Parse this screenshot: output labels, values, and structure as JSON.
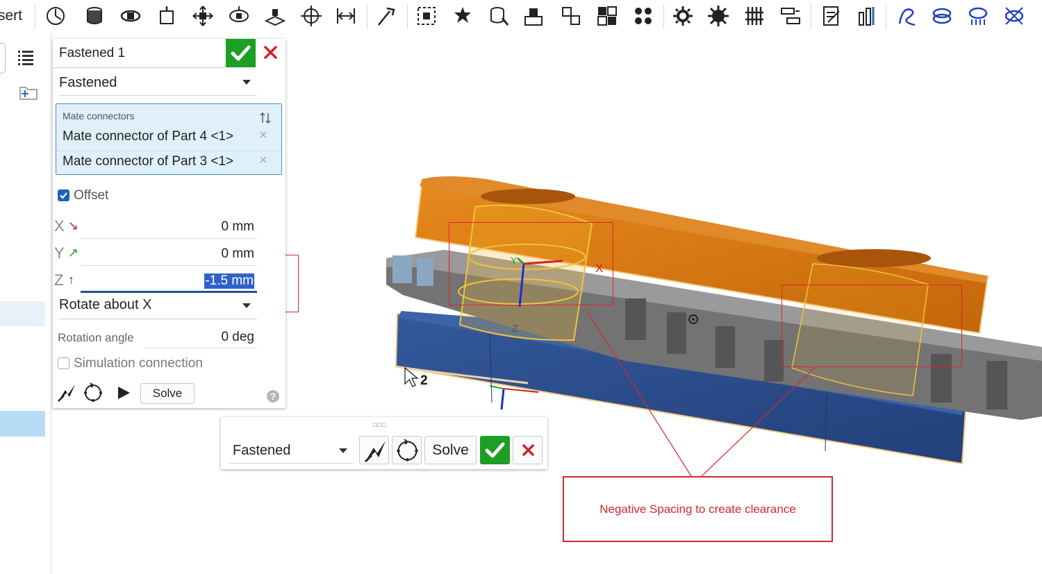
{
  "toolbar": {
    "insert_label": "sert",
    "icons": [
      "clock-icon",
      "cylinder-icon",
      "revolute-icon",
      "slider-icon",
      "move-icon",
      "rotate-icon",
      "planar-icon",
      "cross-move-icon",
      "parallel-icon",
      "wand-icon",
      "select-frame-icon",
      "star-part-icon",
      "part-cursor-icon",
      "assembly-icon",
      "explode-icon",
      "grid-icon",
      "pattern-icon",
      "gear-icon",
      "gear-large-icon",
      "rack-icon",
      "linear-relation-icon",
      "edit-check-icon",
      "chart-icon",
      "curve-icon",
      "ring-icon",
      "ring-arrows-icon",
      "cross-ring-icon"
    ]
  },
  "dialog": {
    "title": "Fastened 1",
    "mate_type": "Fastened",
    "mate_connectors_header": "Mate connectors",
    "mate_connectors": [
      {
        "label": "Mate connector of Part 4 <1>"
      },
      {
        "label": "Mate connector of Part 3 <1>"
      }
    ],
    "remove_glyph": "×",
    "offset_label": "Offset",
    "offset_checked": true,
    "axes": {
      "x": {
        "label": "X",
        "arrow": "↘",
        "value": "0 mm"
      },
      "y": {
        "label": "Y",
        "arrow": "↗",
        "value": "0 mm"
      },
      "z": {
        "label": "Z",
        "arrow": "↑",
        "value": "-1.5 mm"
      }
    },
    "rotate_about": "Rotate about X",
    "rotation_angle_label": "Rotation angle",
    "rotation_angle_value": "0 deg",
    "simulation_label": "Simulation connection",
    "simulation_checked": false,
    "solve_label": "Solve",
    "help_glyph": "?"
  },
  "float_toolbar": {
    "grip": "□□□",
    "mate_type": "Fastened",
    "solve_label": "Solve"
  },
  "viewport": {
    "cursor_label": "2",
    "triad_labels": {
      "x": "X",
      "y": "Y",
      "z": "Z"
    }
  },
  "annotation": {
    "callout_text": "Negative Spacing to create clearance"
  },
  "colors": {
    "accept_green": "#1d9e24",
    "cancel_red": "#d1232a",
    "annotation_red": "#d9262b",
    "selection_blue": "#2f62c9",
    "top_plate_orange": "#d9770e",
    "bottom_plate_blue": "#2a4c8c",
    "gear_gray": "#6c6c6c",
    "highlight_yellow": "#f2c23a"
  }
}
